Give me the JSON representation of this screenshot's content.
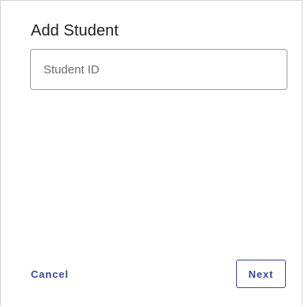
{
  "dialog": {
    "title": "Add Student",
    "student_id_field": {
      "placeholder": "Student ID",
      "value": ""
    },
    "actions": {
      "cancel_label": "Cancel",
      "next_label": "Next"
    }
  },
  "colors": {
    "accent": "#3b4a9c",
    "title_text": "#1f1f1f",
    "field_border": "#9e9e9e",
    "placeholder_text": "#6f6f6f",
    "dialog_border": "#d4d4d4"
  }
}
